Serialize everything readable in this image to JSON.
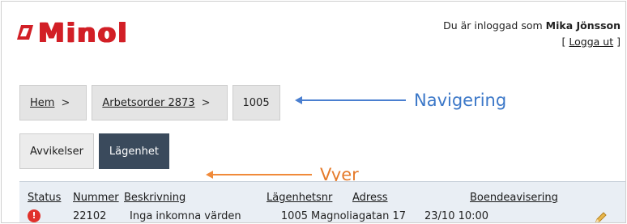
{
  "brand": {
    "name": "Minol"
  },
  "user": {
    "prefix": "Du är inloggad som",
    "name": "Mika Jönsson",
    "logout_label": "Logga ut",
    "bracket_open": "[",
    "bracket_close": "]"
  },
  "breadcrumb": {
    "items": [
      {
        "label": "Hem"
      },
      {
        "label": "Arbetsorder 2873"
      },
      {
        "label": "1005"
      }
    ],
    "separator": ">"
  },
  "annotations": {
    "navigation": {
      "label": "Navigering",
      "color": "#3c78c8"
    },
    "views": {
      "label": "Vyer",
      "color": "#e57a2a"
    }
  },
  "tabs": [
    {
      "label": "Avvikelser",
      "active": false
    },
    {
      "label": "Lägenhet",
      "active": true
    }
  ],
  "table": {
    "columns": [
      "Status",
      "Nummer",
      "Beskrivning",
      "Lägenhetsnr",
      "Adress",
      "Boendeavisering"
    ],
    "rows": [
      {
        "status_icon": "error-icon",
        "nummer": "22102",
        "beskrivning": "Inga inkomna värden",
        "lagenhetsnr": "1005",
        "adress": "Magnoliagatan 17",
        "boendeavisering": "23/10 10:00",
        "action_icon": "pencil-icon"
      }
    ]
  },
  "colors": {
    "brand_red": "#d21f26",
    "active_tab": "#3a4a5c"
  }
}
